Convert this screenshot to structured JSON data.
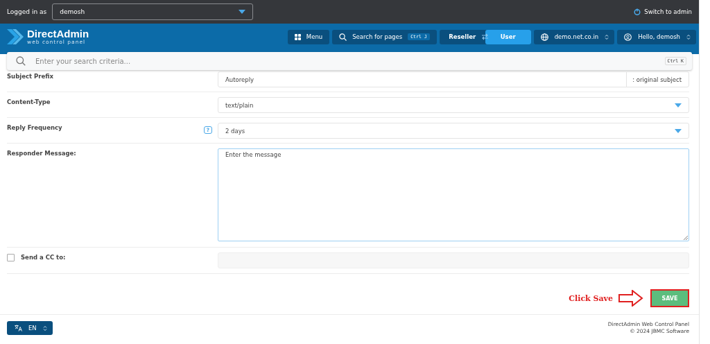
{
  "top_bar": {
    "label": "Logged in as",
    "user_select": "demosh",
    "switch_link": "Switch to admin"
  },
  "header": {
    "logo_title": "DirectAdmin",
    "logo_subtitle": "web control panel",
    "menu_button": "Menu",
    "page_search": {
      "label": "Search for pages",
      "shortcut": "Ctrl J"
    },
    "roles": [
      {
        "label": "Reseller",
        "selected": false
      },
      {
        "label": "User",
        "selected": true
      }
    ],
    "domain": "demo.net.co.in",
    "account": "Hello, demosh"
  },
  "search": {
    "placeholder": "Enter your search criteria...",
    "shortcut": "Ctrl K"
  },
  "form": {
    "rows": [
      {
        "kind": "prefix",
        "label": "Subject Prefix",
        "value": "Autoreply",
        "suffix": ": original subject"
      },
      {
        "kind": "select",
        "label": "Content-Type",
        "value": "text/plain"
      },
      {
        "kind": "select",
        "label": "Reply Frequency",
        "value": "2 days",
        "help": "?"
      },
      {
        "kind": "textarea",
        "label": "Responder Message:",
        "value": "Enter the message"
      },
      {
        "kind": "checkbox",
        "label": "Send a CC to:",
        "checked": false
      }
    ]
  },
  "annotation": {
    "text": "Click Save"
  },
  "save_button": "SAVE",
  "footer": {
    "language": "EN",
    "lines": [
      "DirectAdmin Web Control Panel",
      "© 2024 JBMC Software"
    ]
  }
}
